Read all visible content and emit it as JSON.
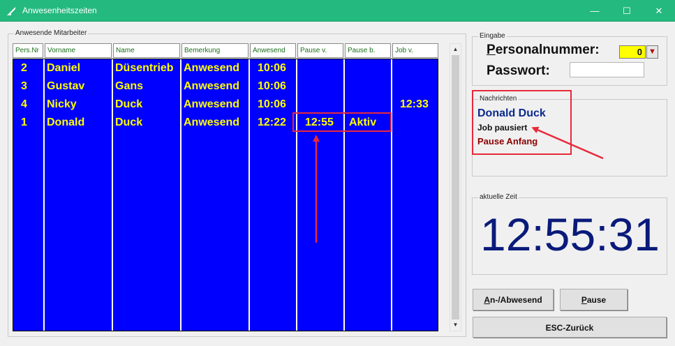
{
  "window": {
    "title": "Anwesenheitszeiten",
    "minimize": "—",
    "maximize": "☐",
    "close": "✕"
  },
  "attendance": {
    "legend": "Anwesende Mitarbeiter",
    "columns": [
      "Pers.Nr",
      "Vorname",
      "Name",
      "Bemerkung",
      "Anwesend",
      "Pause v.",
      "Pause b.",
      "Job v."
    ],
    "rows": [
      {
        "pers_nr": "2",
        "vorname": "Daniel",
        "name": "Düsentrieb",
        "bemerkung": "Anwesend",
        "anwesend": "10:06",
        "pause_v": "",
        "pause_b": "",
        "job_v": ""
      },
      {
        "pers_nr": "3",
        "vorname": "Gustav",
        "name": "Gans",
        "bemerkung": "Anwesend",
        "anwesend": "10:06",
        "pause_v": "",
        "pause_b": "",
        "job_v": ""
      },
      {
        "pers_nr": "4",
        "vorname": "Nicky",
        "name": "Duck",
        "bemerkung": "Anwesend",
        "anwesend": "10:06",
        "pause_v": "",
        "pause_b": "",
        "job_v": "12:33"
      },
      {
        "pers_nr": "1",
        "vorname": "Donald",
        "name": "Duck",
        "bemerkung": "Anwesend",
        "anwesend": "12:22",
        "pause_v": "12:55",
        "pause_b": "Aktiv",
        "job_v": ""
      }
    ]
  },
  "eingabe": {
    "legend": "Eingabe",
    "personalnummer_label_first": "P",
    "personalnummer_label_rest": "ersonalnummer:",
    "personalnummer_value": "0",
    "passwort_label": "Passwort:",
    "passwort_value": ""
  },
  "nachrichten": {
    "legend": "Nachrichten",
    "name": "Donald Duck",
    "status": "Job pausiert",
    "event": "Pause Anfang"
  },
  "zeit": {
    "legend": "aktuelle Zeit",
    "value": "12:55:31"
  },
  "buttons": {
    "an_abwesend_first": "A",
    "an_abwesend_rest": "n-/Abwesend",
    "pause_first": "P",
    "pause_rest": "ause",
    "esc": "ESC-Zurück"
  },
  "colors": {
    "titlebar": "#24b97f",
    "grid_bg": "#0000ff",
    "grid_text": "#ffff00",
    "annotation": "#e8293a"
  }
}
